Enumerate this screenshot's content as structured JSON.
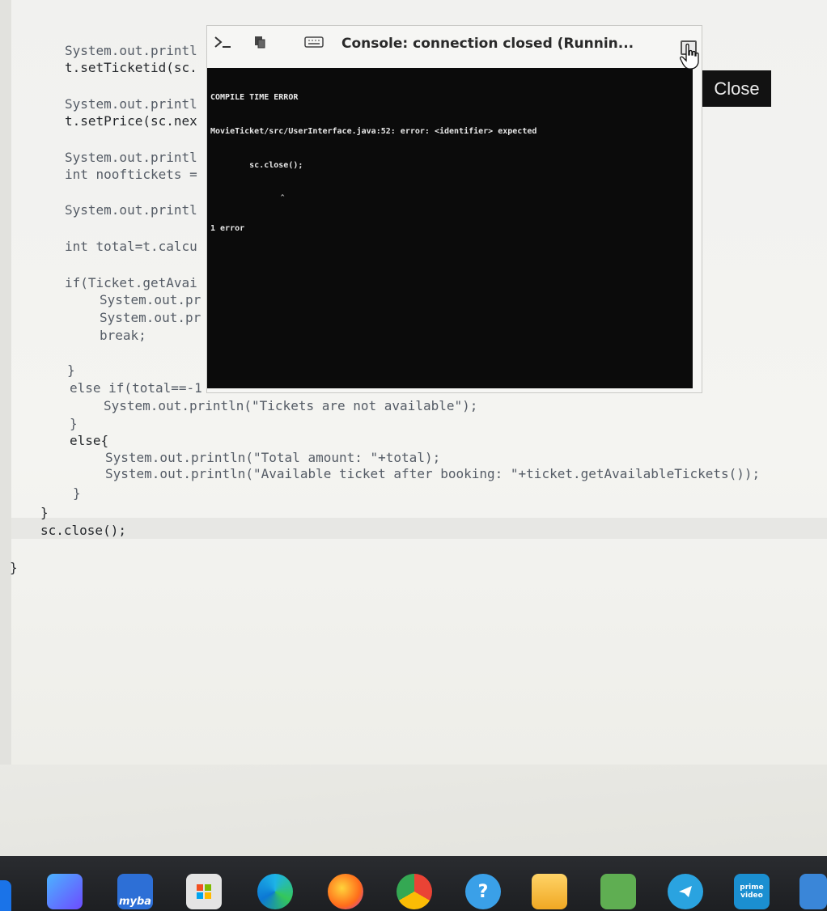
{
  "editor": {
    "lines": [
      "System.out.printl",
      "t.setTicketid(sc.",
      "System.out.printl",
      "t.setPrice(sc.nex",
      "System.out.printl",
      "int nooftickets =",
      "System.out.printl",
      "int total=t.calcu",
      "if(Ticket.getAvai",
      "System.out.pr",
      "System.out.pr",
      "break;",
      "}",
      "else if(total==-1",
      "System.out.println(\"Tickets are not available\");",
      "}",
      "else{",
      "System.out.println(\"Total amount: \"+total);",
      "System.out.println(\"Available ticket after booking: \"+ticket.getAvailableTickets());",
      "}",
      "}",
      "sc.close();",
      "}"
    ]
  },
  "console": {
    "title": "Console: connection closed (Runnin...",
    "output": [
      "COMPILE TIME ERROR",
      "MovieTicket/src/UserInterface.java:52: error: <identifier> expected",
      "        sc.close();",
      "                  ^",
      "1 error"
    ],
    "icons": [
      "terminal-icon",
      "copy-icon",
      "keyboard-icon",
      "maximize-icon"
    ]
  },
  "close_button": {
    "label": "Close"
  },
  "taskbar": {
    "apps": [
      {
        "name": "copilot-icon",
        "color": "#3f7ee8"
      },
      {
        "name": "myba-icon",
        "label": "myba",
        "color": "#2d6fd6"
      },
      {
        "name": "microsoft-store-icon",
        "color": "#d9d9d9"
      },
      {
        "name": "edge-icon",
        "color": "#1b9de2"
      },
      {
        "name": "firefox-icon",
        "color": "#ff7a18"
      },
      {
        "name": "chrome-icon",
        "color": "#4a8fe7"
      },
      {
        "name": "help-icon",
        "color": "#3aa0e8"
      },
      {
        "name": "file-explorer-icon",
        "color": "#f0b233"
      },
      {
        "name": "photos-icon",
        "color": "#57a84a"
      },
      {
        "name": "telegram-icon",
        "color": "#2aa3e0"
      },
      {
        "name": "prime-video-icon",
        "label": "prime video",
        "color": "#1b8fd1"
      },
      {
        "name": "app-icon",
        "color": "#3a86d8"
      }
    ]
  }
}
